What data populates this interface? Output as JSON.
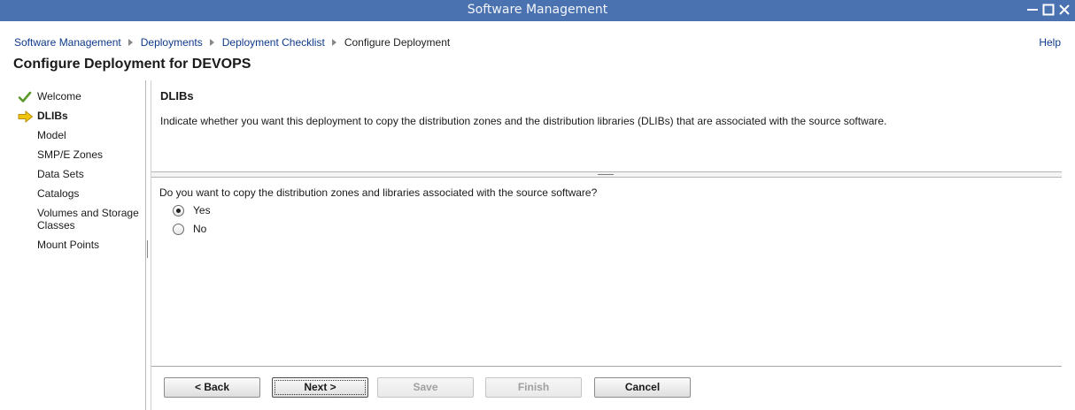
{
  "window": {
    "title": "Software Management",
    "controls": [
      "minimize-icon",
      "maximize-icon",
      "close-icon"
    ]
  },
  "breadcrumb": {
    "items": [
      {
        "label": "Software Management",
        "link": true
      },
      {
        "label": "Deployments",
        "link": true
      },
      {
        "label": "Deployment Checklist",
        "link": true
      },
      {
        "label": "Configure Deployment",
        "link": false
      }
    ]
  },
  "help": {
    "label": "Help"
  },
  "page": {
    "title": "Configure Deployment for DEVOPS"
  },
  "steps": [
    {
      "label": "Welcome",
      "status": "complete",
      "icon": "checkmark-icon"
    },
    {
      "label": "DLIBs",
      "status": "current",
      "icon": "arrow-right-icon"
    },
    {
      "label": "Model",
      "status": "pending"
    },
    {
      "label": "SMP/E Zones",
      "status": "pending"
    },
    {
      "label": "Data Sets",
      "status": "pending"
    },
    {
      "label": "Catalogs",
      "status": "pending"
    },
    {
      "label": "Volumes and Storage Classes",
      "status": "pending"
    },
    {
      "label": "Mount Points",
      "status": "pending"
    }
  ],
  "section": {
    "title": "DLIBs",
    "description": "Indicate whether you want this deployment to copy the distribution zones and the distribution libraries (DLIBs) that are associated with the source software."
  },
  "question": {
    "label": "Do you want to copy the distribution zones and libraries associated with the source software?",
    "options": [
      {
        "label": "Yes",
        "selected": true
      },
      {
        "label": "No",
        "selected": false
      }
    ]
  },
  "buttons": {
    "back": {
      "label": "< Back",
      "enabled": true
    },
    "next": {
      "label": "Next >",
      "enabled": true,
      "default": true
    },
    "save": {
      "label": "Save",
      "enabled": false
    },
    "finish": {
      "label": "Finish",
      "enabled": false
    },
    "cancel": {
      "label": "Cancel",
      "enabled": true
    }
  },
  "colors": {
    "titlebar": "#4a72b0",
    "link": "#0f3a8a",
    "check": "#5a9a2a",
    "arrow": "#f1c40f"
  }
}
